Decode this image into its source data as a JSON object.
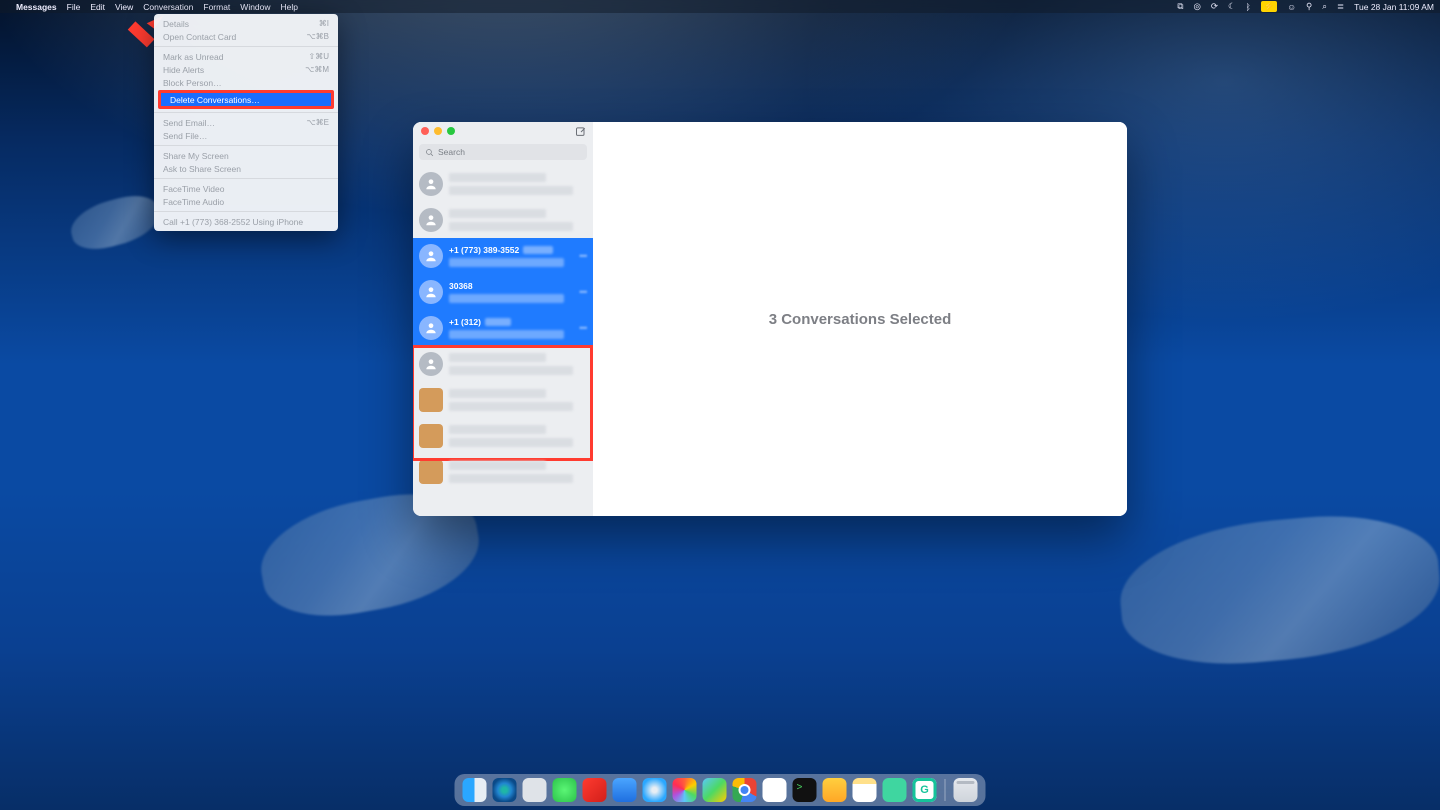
{
  "menubar": {
    "apple_glyph": "",
    "app_name": "Messages",
    "items": [
      "File",
      "Edit",
      "View",
      "Conversation",
      "Format",
      "Window",
      "Help"
    ],
    "right_status": {
      "icons": [
        "screen-mirror-icon",
        "siri-icon",
        "refresh-icon",
        "moon-icon",
        "bluetooth-icon",
        "battery-icon",
        "user-icon",
        "wifi-icon",
        "search-icon",
        "control-center-icon"
      ],
      "clock": "Tue 28 Jan  11:09 AM"
    }
  },
  "dropdown": {
    "group1": [
      {
        "label": "Details",
        "shortcut": "⌘I",
        "dim": true
      },
      {
        "label": "Open Contact Card",
        "shortcut": "⌥⌘B",
        "dim": true
      }
    ],
    "group2": [
      {
        "label": "Mark as Unread",
        "shortcut": "⇧⌘U",
        "dim": true
      },
      {
        "label": "Hide Alerts",
        "shortcut": "⌥⌘M",
        "dim": true
      },
      {
        "label": "Block Person…",
        "shortcut": "",
        "dim": true
      }
    ],
    "highlighted": {
      "label": "Delete Conversations…",
      "shortcut": ""
    },
    "group3": [
      {
        "label": "Send Email…",
        "shortcut": "⌥⌘E",
        "dim": true
      },
      {
        "label": "Send File…",
        "shortcut": "",
        "dim": true
      }
    ],
    "group4": [
      {
        "label": "Share My Screen",
        "shortcut": "",
        "dim": true
      },
      {
        "label": "Ask to Share Screen",
        "shortcut": "",
        "dim": true
      }
    ],
    "group5": [
      {
        "label": "FaceTime Video",
        "shortcut": "",
        "dim": true
      },
      {
        "label": "FaceTime Audio",
        "shortcut": "",
        "dim": true
      }
    ],
    "group6": [
      {
        "label": "Call +1 (773) 368-2552 Using iPhone",
        "shortcut": "",
        "dim": true
      }
    ]
  },
  "messages_window": {
    "search_placeholder": "Search",
    "main_status": "3 Conversations Selected",
    "conversations_visible_title_1": "+1 (773) 389-3552",
    "conversations_visible_title_2": "30368",
    "conversations_visible_title_3": "+1 (312)"
  },
  "dock": {
    "apps": [
      "finder",
      "edge",
      "generic",
      "messages",
      "red",
      "mail",
      "safari",
      "photos",
      "maps",
      "chrome",
      "slack",
      "iterm",
      "pages",
      "notes",
      "mint",
      "grammarly"
    ],
    "trash_label": "trash"
  }
}
